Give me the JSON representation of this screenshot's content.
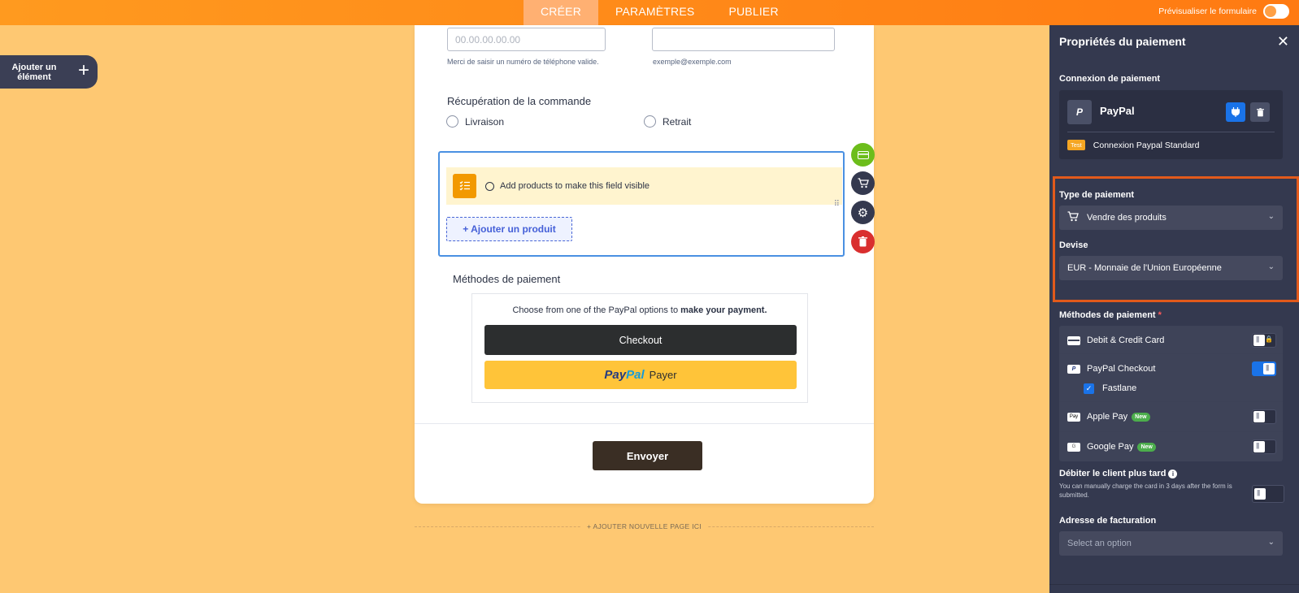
{
  "topbar": {
    "tabs": [
      {
        "label": "CRÉER",
        "active": true
      },
      {
        "label": "PARAMÈTRES",
        "active": false
      },
      {
        "label": "PUBLIER",
        "active": false
      }
    ],
    "preview_label": "Prévisualiser le formulaire"
  },
  "add_element": {
    "label": "Ajouter un élément"
  },
  "form": {
    "phone": {
      "placeholder": "00.00.00.00.00",
      "hint": "Merci de saisir un numéro de téléphone valide."
    },
    "email": {
      "value": "",
      "hint": "exemple@exemple.com"
    },
    "order_pickup": {
      "label": "Récupération de la commande",
      "options": [
        "Livraison",
        "Retrait"
      ]
    },
    "products": {
      "notice": "Add products to make this field visible",
      "add_button": "+ Ajouter un produit"
    },
    "payment_methods": {
      "label": "Méthodes de paiement",
      "text_prefix": "Choose from one of the PayPal options to ",
      "text_bold": "make your payment.",
      "checkout_label": "Checkout",
      "paypal_logo_a": "Pay",
      "paypal_logo_b": "Pal",
      "paypal_label": "Payer"
    },
    "submit_label": "Envoyer",
    "add_page_label": "+ AJOUTER NOUVELLE PAGE ICI"
  },
  "panel": {
    "title": "Propriétés du paiement",
    "connection": {
      "title": "Connexion de paiement",
      "provider": "PayPal",
      "mode_badge": "Test",
      "mode_label": "Connexion Paypal Standard"
    },
    "payment_type": {
      "label": "Type de paiement",
      "value": "Vendre des produits"
    },
    "currency": {
      "label": "Devise",
      "value": "EUR - Monnaie de l'Union Européenne"
    },
    "methods": {
      "title": "Méthodes de paiement",
      "required_mark": "*",
      "items": [
        {
          "label": "Debit & Credit Card",
          "enabled": false,
          "locked": true
        },
        {
          "label": "PayPal Checkout",
          "enabled": true
        },
        {
          "label": "Apple Pay",
          "badge": "New",
          "enabled": false
        },
        {
          "label": "Google Pay",
          "badge": "New",
          "enabled": false
        }
      ],
      "fastlane": {
        "label": "Fastlane",
        "checked": true
      }
    },
    "charge_later": {
      "title": "Débiter le client plus tard",
      "desc": "You can manually charge the card in 3 days after the form is submitted.",
      "enabled": false
    },
    "billing": {
      "label": "Adresse de facturation",
      "placeholder": "Select an option"
    }
  },
  "colors": {
    "accent_orange": "#ff8a1a",
    "highlight": "#e25a1b",
    "panel_bg": "#34394f",
    "toggle_on": "#1a73e8"
  }
}
